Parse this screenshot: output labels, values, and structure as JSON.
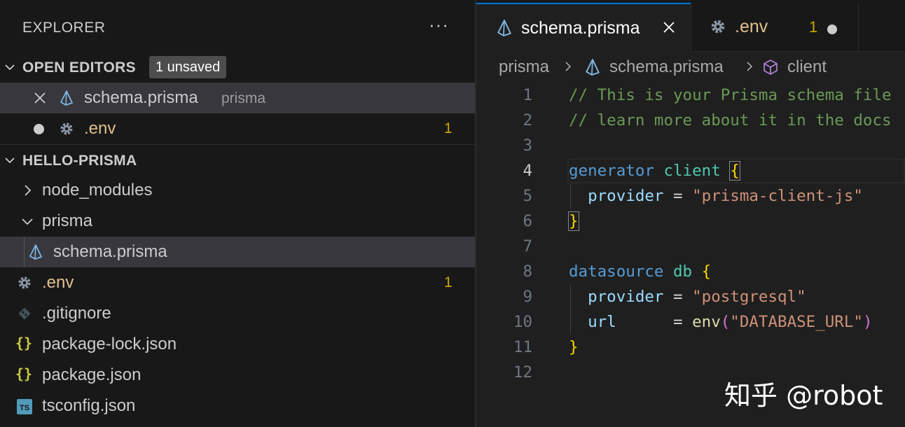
{
  "sidebar": {
    "title": "EXPLORER",
    "more_label": "···",
    "open_editors": {
      "label": "OPEN EDITORS",
      "badge": "1 unsaved",
      "items": [
        {
          "name": "schema.prisma",
          "description": "prisma",
          "icon": "prisma-icon"
        },
        {
          "name": ".env",
          "count": "1",
          "icon": "gear-icon"
        }
      ]
    },
    "project": {
      "label": "HELLO-PRISMA",
      "items": [
        {
          "name": "node_modules",
          "icon": "chevron-right-icon"
        },
        {
          "name": "prisma",
          "icon": "chevron-down-icon"
        },
        {
          "name": "schema.prisma",
          "icon": "prisma-icon"
        },
        {
          "name": ".env",
          "count": "1",
          "icon": "gear-icon"
        },
        {
          "name": ".gitignore",
          "icon": "git-icon"
        },
        {
          "name": "package-lock.json",
          "icon": "json-braces-icon"
        },
        {
          "name": "package.json",
          "icon": "json-braces-icon"
        },
        {
          "name": "tsconfig.json",
          "icon": "ts-icon"
        }
      ]
    }
  },
  "tabs": [
    {
      "label": "schema.prisma",
      "icon": "prisma-icon",
      "active": true
    },
    {
      "label": ".env",
      "icon": "gear-icon",
      "count": "1",
      "unsaved": true
    }
  ],
  "breadcrumb": [
    "prisma",
    "schema.prisma",
    "client"
  ],
  "code": {
    "line_numbers": [
      "1",
      "2",
      "3",
      "4",
      "5",
      "6",
      "7",
      "8",
      "9",
      "10",
      "11",
      "12"
    ],
    "current_line": "4",
    "lines": {
      "l1": "// This is your Prisma schema file",
      "l2": "// learn more about it in the docs",
      "l4_kw": "generator",
      "l4_name": "client",
      "l5_prop": "provider",
      "l5_val": "\"prisma-client-js\"",
      "l8_kw": "datasource",
      "l8_name": "db",
      "l9_prop": "provider",
      "l9_val": "\"postgresql\"",
      "l10_prop": "url",
      "l10_fn": "env",
      "l10_val": "\"DATABASE_URL\"",
      "open_brace": "{",
      "close_brace": "}",
      "equals": "=",
      "open_paren": "(",
      "close_paren": ")"
    }
  },
  "watermark": "知乎 @robot",
  "colors": {
    "accent": "#0078d4",
    "modified": "#e2c08d",
    "warning_count": "#cca700"
  }
}
